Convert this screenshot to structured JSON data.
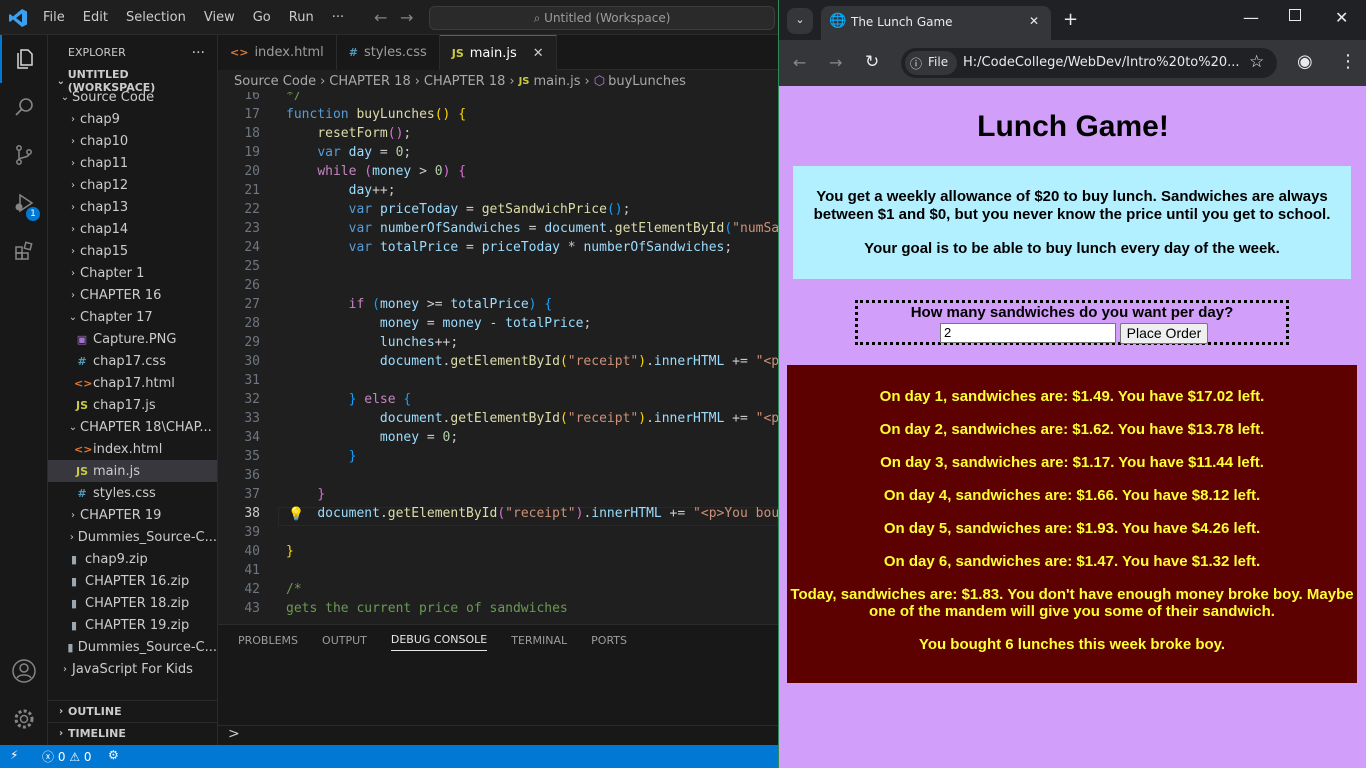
{
  "vscode": {
    "menu": [
      "File",
      "Edit",
      "Selection",
      "View",
      "Go",
      "Run",
      "···"
    ],
    "command_center": "Untitled (Workspace)",
    "explorer_title": "EXPLORER",
    "explorer_more": "···",
    "workspace": "UNTITLED (WORKSPACE)",
    "tree": [
      {
        "label": "Source Code",
        "type": "folder",
        "open": true,
        "indent": 1
      },
      {
        "label": "chap9",
        "type": "folder",
        "indent": 2
      },
      {
        "label": "chap10",
        "type": "folder",
        "indent": 2
      },
      {
        "label": "chap11",
        "type": "folder",
        "indent": 2
      },
      {
        "label": "chap12",
        "type": "folder",
        "indent": 2
      },
      {
        "label": "chap13",
        "type": "folder",
        "indent": 2
      },
      {
        "label": "chap14",
        "type": "folder",
        "indent": 2
      },
      {
        "label": "chap15",
        "type": "folder",
        "indent": 2
      },
      {
        "label": "Chapter 1",
        "type": "folder",
        "indent": 2
      },
      {
        "label": "CHAPTER 16",
        "type": "folder",
        "indent": 2
      },
      {
        "label": "Chapter 17",
        "type": "folder",
        "open": true,
        "indent": 2
      },
      {
        "label": "Capture.PNG",
        "type": "png",
        "indent": 3
      },
      {
        "label": "chap17.css",
        "type": "css",
        "indent": 3
      },
      {
        "label": "chap17.html",
        "type": "html",
        "indent": 3
      },
      {
        "label": "chap17.js",
        "type": "js",
        "indent": 3
      },
      {
        "label": "CHAPTER 18\\CHAP...",
        "type": "folder",
        "open": true,
        "indent": 2
      },
      {
        "label": "index.html",
        "type": "html",
        "indent": 3
      },
      {
        "label": "main.js",
        "type": "js",
        "indent": 3,
        "selected": true
      },
      {
        "label": "styles.css",
        "type": "css",
        "indent": 3
      },
      {
        "label": "CHAPTER 19",
        "type": "folder",
        "indent": 2
      },
      {
        "label": "Dummies_Source-C...",
        "type": "folder",
        "indent": 2
      },
      {
        "label": "chap9.zip",
        "type": "zip",
        "indent": 2
      },
      {
        "label": "CHAPTER 16.zip",
        "type": "zip",
        "indent": 2
      },
      {
        "label": "CHAPTER 18.zip",
        "type": "zip",
        "indent": 2
      },
      {
        "label": "CHAPTER 19.zip",
        "type": "zip",
        "indent": 2
      },
      {
        "label": "Dummies_Source-C...",
        "type": "zip",
        "indent": 2
      },
      {
        "label": "JavaScript For Kids",
        "type": "folder",
        "indent": 1
      }
    ],
    "outline": "OUTLINE",
    "timeline": "TIMELINE",
    "tabs": [
      {
        "label": "index.html",
        "type": "html",
        "active": false
      },
      {
        "label": "styles.css",
        "type": "css",
        "active": false
      },
      {
        "label": "main.js",
        "type": "js",
        "active": true
      }
    ],
    "breadcrumb": [
      "Source Code",
      "CHAPTER 18",
      "CHAPTER 18",
      "main.js",
      "buyLunches"
    ],
    "line_numbers": [
      "16",
      "17",
      "18",
      "19",
      "20",
      "21",
      "22",
      "23",
      "24",
      "25",
      "26",
      "27",
      "28",
      "29",
      "30",
      "31",
      "32",
      "33",
      "34",
      "35",
      "36",
      "37",
      "38",
      "39",
      "40",
      "41",
      "42",
      "43"
    ],
    "current_line": "38",
    "panel_tabs": [
      "PROBLEMS",
      "OUTPUT",
      "DEBUG CONSOLE",
      "TERMINAL",
      "PORTS"
    ],
    "active_panel": "DEBUG CONSOLE",
    "panel_prompt": ">",
    "status": {
      "errors": "0",
      "warnings": "0"
    },
    "debug_badge": "1"
  },
  "browser": {
    "tab_title": "The Lunch Game",
    "url_scheme": "File",
    "url": "H:/CodeCollege/WebDev/Intro%20to%20...",
    "page": {
      "title": "Lunch Game!",
      "intro": "You get a weekly allowance of $20 to buy lunch. Sandwiches are always between $1 and $0, but you never know the price until you get to school.",
      "goal": "Your goal is to be able to buy lunch every day of the week.",
      "question": "How many sandwiches do you want per day?",
      "input_value": "2",
      "button": "Place Order",
      "receipt": [
        "On day 1, sandwiches are: $1.49. You have $17.02 left.",
        "On day 2, sandwiches are: $1.62. You have $13.78 left.",
        "On day 3, sandwiches are: $1.17. You have $11.44 left.",
        "On day 4, sandwiches are: $1.66. You have $8.12 left.",
        "On day 5, sandwiches are: $1.93. You have $4.26 left.",
        "On day 6, sandwiches are: $1.47. You have $1.32 left.",
        "Today, sandwiches are: $1.83. You don't have enough money broke boy. Maybe one of the mandem will give you some of their sandwich.",
        "You bought 6 lunches this week broke boy."
      ]
    }
  },
  "colors": {
    "accent": "#0078d4",
    "page_bg": "#d19ffa",
    "info_bg": "#b3f0ff",
    "receipt_bg": "#5c0000",
    "receipt_text": "#ffff33"
  }
}
